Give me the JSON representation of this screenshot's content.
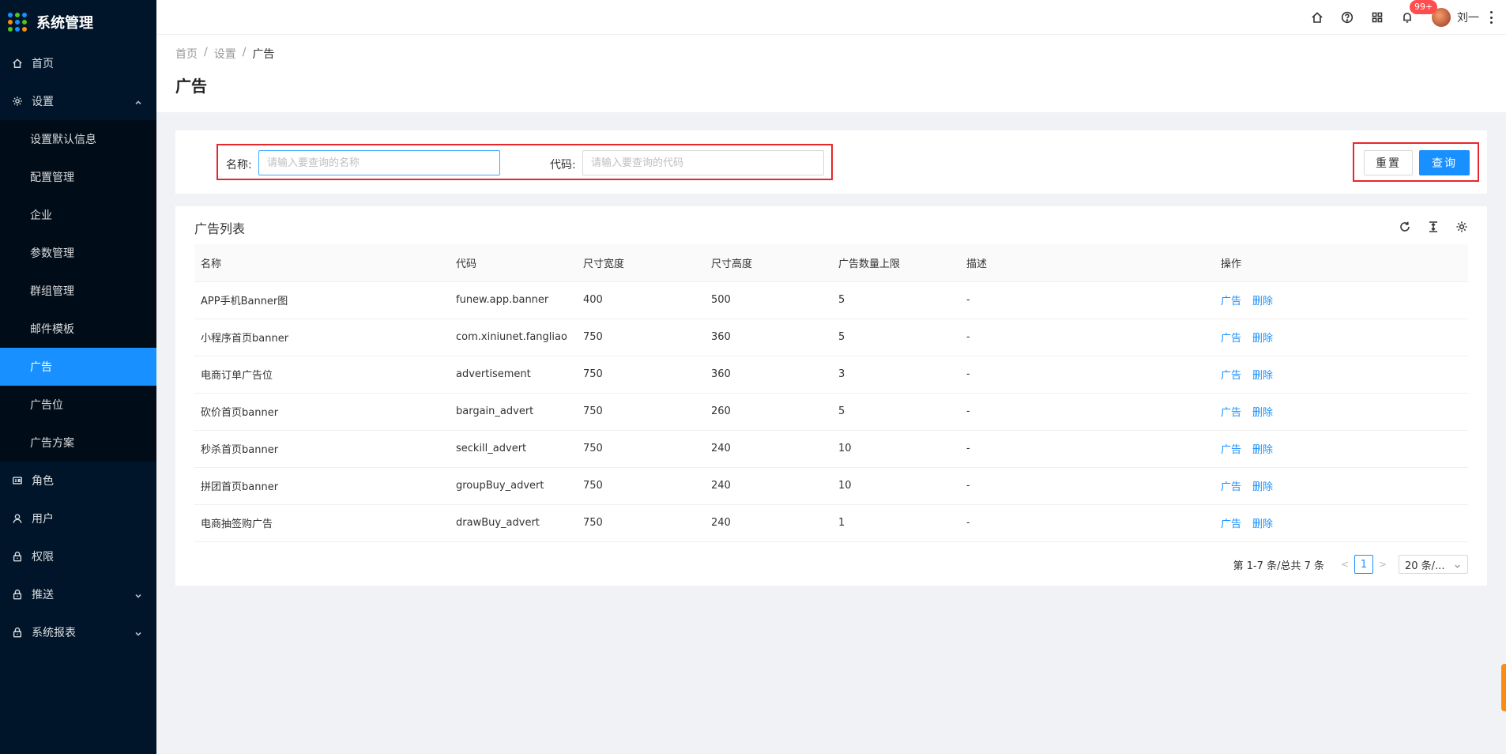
{
  "app": {
    "title": "系统管理"
  },
  "sidebar": {
    "items": [
      {
        "label": "首页",
        "icon": "home-icon"
      },
      {
        "label": "设置",
        "icon": "gear-icon",
        "expanded": true,
        "children": [
          {
            "label": "设置默认信息"
          },
          {
            "label": "配置管理"
          },
          {
            "label": "企业"
          },
          {
            "label": "参数管理"
          },
          {
            "label": "群组管理"
          },
          {
            "label": "邮件模板"
          },
          {
            "label": "广告",
            "active": true
          },
          {
            "label": "广告位"
          },
          {
            "label": "广告方案"
          }
        ]
      },
      {
        "label": "角色",
        "icon": "id-card-icon"
      },
      {
        "label": "用户",
        "icon": "user-icon"
      },
      {
        "label": "权限",
        "icon": "lock-icon"
      },
      {
        "label": "推送",
        "icon": "lock-icon"
      },
      {
        "label": "系统报表",
        "icon": "lock-icon"
      }
    ]
  },
  "header": {
    "notification_count": "99+",
    "username": "刘一"
  },
  "breadcrumb": [
    "首页",
    "设置",
    "广告"
  ],
  "page": {
    "title": "广告"
  },
  "search": {
    "name_label": "名称:",
    "name_placeholder": "请输入要查询的名称",
    "code_label": "代码:",
    "code_placeholder": "请输入要查询的代码",
    "reset_label": "重置",
    "query_label": "查询"
  },
  "table": {
    "title": "广告列表",
    "columns": [
      "名称",
      "代码",
      "尺寸宽度",
      "尺寸高度",
      "广告数量上限",
      "描述",
      "操作"
    ],
    "rows": [
      {
        "name": "APP手机Banner图",
        "code": "funew.app.banner",
        "width": "400",
        "height": "500",
        "limit": "5",
        "desc": "-"
      },
      {
        "name": "小程序首页banner",
        "code": "com.xiniunet.fangliao",
        "width": "750",
        "height": "360",
        "limit": "5",
        "desc": "-"
      },
      {
        "name": "电商订单广告位",
        "code": "advertisement",
        "width": "750",
        "height": "360",
        "limit": "3",
        "desc": "-"
      },
      {
        "name": "砍价首页banner",
        "code": "bargain_advert",
        "width": "750",
        "height": "260",
        "limit": "5",
        "desc": "-"
      },
      {
        "name": "秒杀首页banner",
        "code": "seckill_advert",
        "width": "750",
        "height": "240",
        "limit": "10",
        "desc": "-"
      },
      {
        "name": "拼团首页banner",
        "code": "groupBuy_advert",
        "width": "750",
        "height": "240",
        "limit": "10",
        "desc": "-"
      },
      {
        "name": "电商抽签购广告",
        "code": "drawBuy_advert",
        "width": "750",
        "height": "240",
        "limit": "1",
        "desc": "-"
      }
    ],
    "row_actions": {
      "ad": "广告",
      "delete": "删除"
    }
  },
  "pagination": {
    "total_text": "第 1-7 条/总共 7 条",
    "current_page": "1",
    "page_size": "20 条/..."
  }
}
